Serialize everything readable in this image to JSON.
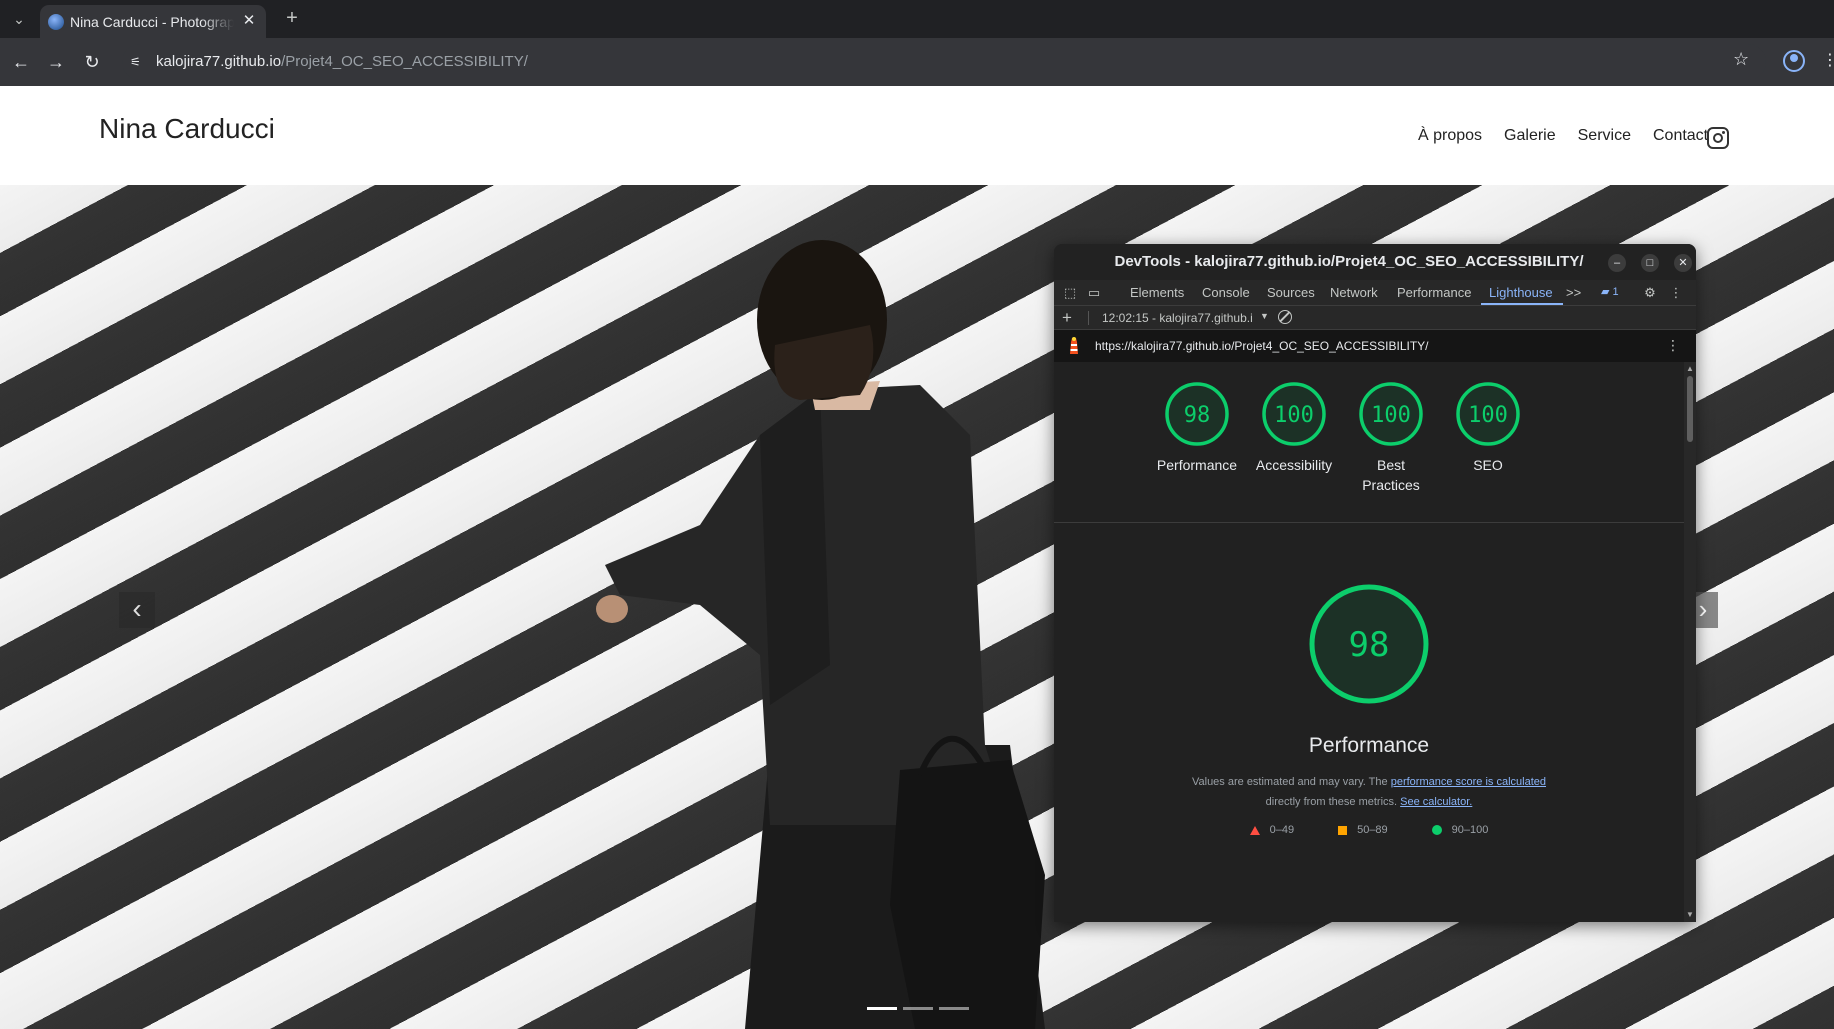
{
  "browser": {
    "tab_title": "Nina Carducci - Photographe",
    "url_host": "kalojira77.github.io",
    "url_path": "/Projet4_OC_SEO_ACCESSIBILITY/"
  },
  "site": {
    "title": "Nina Carducci",
    "nav": [
      "À propos",
      "Galerie",
      "Service",
      "Contact"
    ],
    "carousel": {
      "slides": 3,
      "active_slide": 1
    }
  },
  "devtools": {
    "window_title": "DevTools - kalojira77.github.io/Projet4_OC_SEO_ACCESSIBILITY/",
    "tabs": [
      "Elements",
      "Console",
      "Sources",
      "Network",
      "Performance",
      "Lighthouse"
    ],
    "active_tab": "Lighthouse",
    "more_tabs": ">>",
    "issues_badge": "1",
    "report_selector": "12:02:15 - kalojira77.github.i",
    "report_url": "https://kalojira77.github.io/Projet4_OC_SEO_ACCESSIBILITY/"
  },
  "lighthouse": {
    "scores": [
      {
        "label": "Performance",
        "value": "98"
      },
      {
        "label": "Accessibility",
        "value": "100"
      },
      {
        "label": "Best Practices",
        "value": "100"
      },
      {
        "label": "SEO",
        "value": "100"
      }
    ],
    "main_score": "98",
    "main_title": "Performance",
    "note_prefix": "Values are estimated and may vary. The",
    "note_link1": "performance score is calculated",
    "note_middle": "directly from these metrics.",
    "note_link2": "See calculator.",
    "legend": [
      "0–49",
      "50–89",
      "90–100"
    ],
    "colors": {
      "pass": "#0cce6b",
      "average": "#ffa400",
      "fail": "#ff4e42"
    }
  }
}
